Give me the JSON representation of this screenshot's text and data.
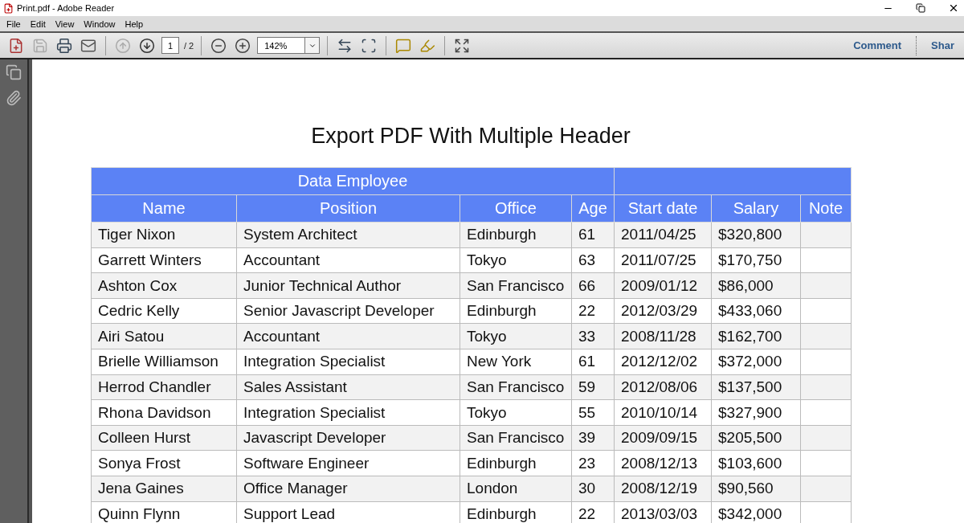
{
  "window": {
    "title": "Print.pdf - Adobe Reader"
  },
  "menu": [
    "File",
    "Edit",
    "View",
    "Window",
    "Help"
  ],
  "toolbar": {
    "page_current": "1",
    "page_total": "/ 2",
    "zoom": "142%",
    "links": [
      "Comment",
      "Shar"
    ]
  },
  "document": {
    "title": "Export PDF With Multiple Header",
    "table": {
      "header_groups": [
        {
          "label": "Data Employee",
          "columns": [
            "Name",
            "Position",
            "Office",
            "Age"
          ]
        },
        {
          "columns": [
            "Start date",
            "Salary",
            "Note"
          ]
        }
      ],
      "rows": [
        [
          "Tiger Nixon",
          "System Architect",
          "Edinburgh",
          "61",
          "2011/04/25",
          "$320,800"
        ],
        [
          "Garrett Winters",
          "Accountant",
          "Tokyo",
          "63",
          "2011/07/25",
          "$170,750"
        ],
        [
          "Ashton Cox",
          "Junior Technical Author",
          "San Francisco",
          "66",
          "2009/01/12",
          "$86,000"
        ],
        [
          "Cedric Kelly",
          "Senior Javascript Developer",
          "Edinburgh",
          "22",
          "2012/03/29",
          "$433,060"
        ],
        [
          "Airi Satou",
          "Accountant",
          "Tokyo",
          "33",
          "2008/11/28",
          "$162,700"
        ],
        [
          "Brielle Williamson",
          "Integration Specialist",
          "New York",
          "61",
          "2012/12/02",
          "$372,000"
        ],
        [
          "Herrod Chandler",
          "Sales Assistant",
          "San Francisco",
          "59",
          "2012/08/06",
          "$137,500"
        ],
        [
          "Rhona Davidson",
          "Integration Specialist",
          "Tokyo",
          "55",
          "2010/10/14",
          "$327,900"
        ],
        [
          "Colleen Hurst",
          "Javascript Developer",
          "San Francisco",
          "39",
          "2009/09/15",
          "$205,500"
        ],
        [
          "Sonya Frost",
          "Software Engineer",
          "Edinburgh",
          "23",
          "2008/12/13",
          "$103,600"
        ],
        [
          "Jena Gaines",
          "Office Manager",
          "London",
          "30",
          "2008/12/19",
          "$90,560"
        ],
        [
          "Quinn Flynn",
          "Support Lead",
          "Edinburgh",
          "22",
          "2013/03/03",
          "$342,000"
        ]
      ]
    }
  }
}
